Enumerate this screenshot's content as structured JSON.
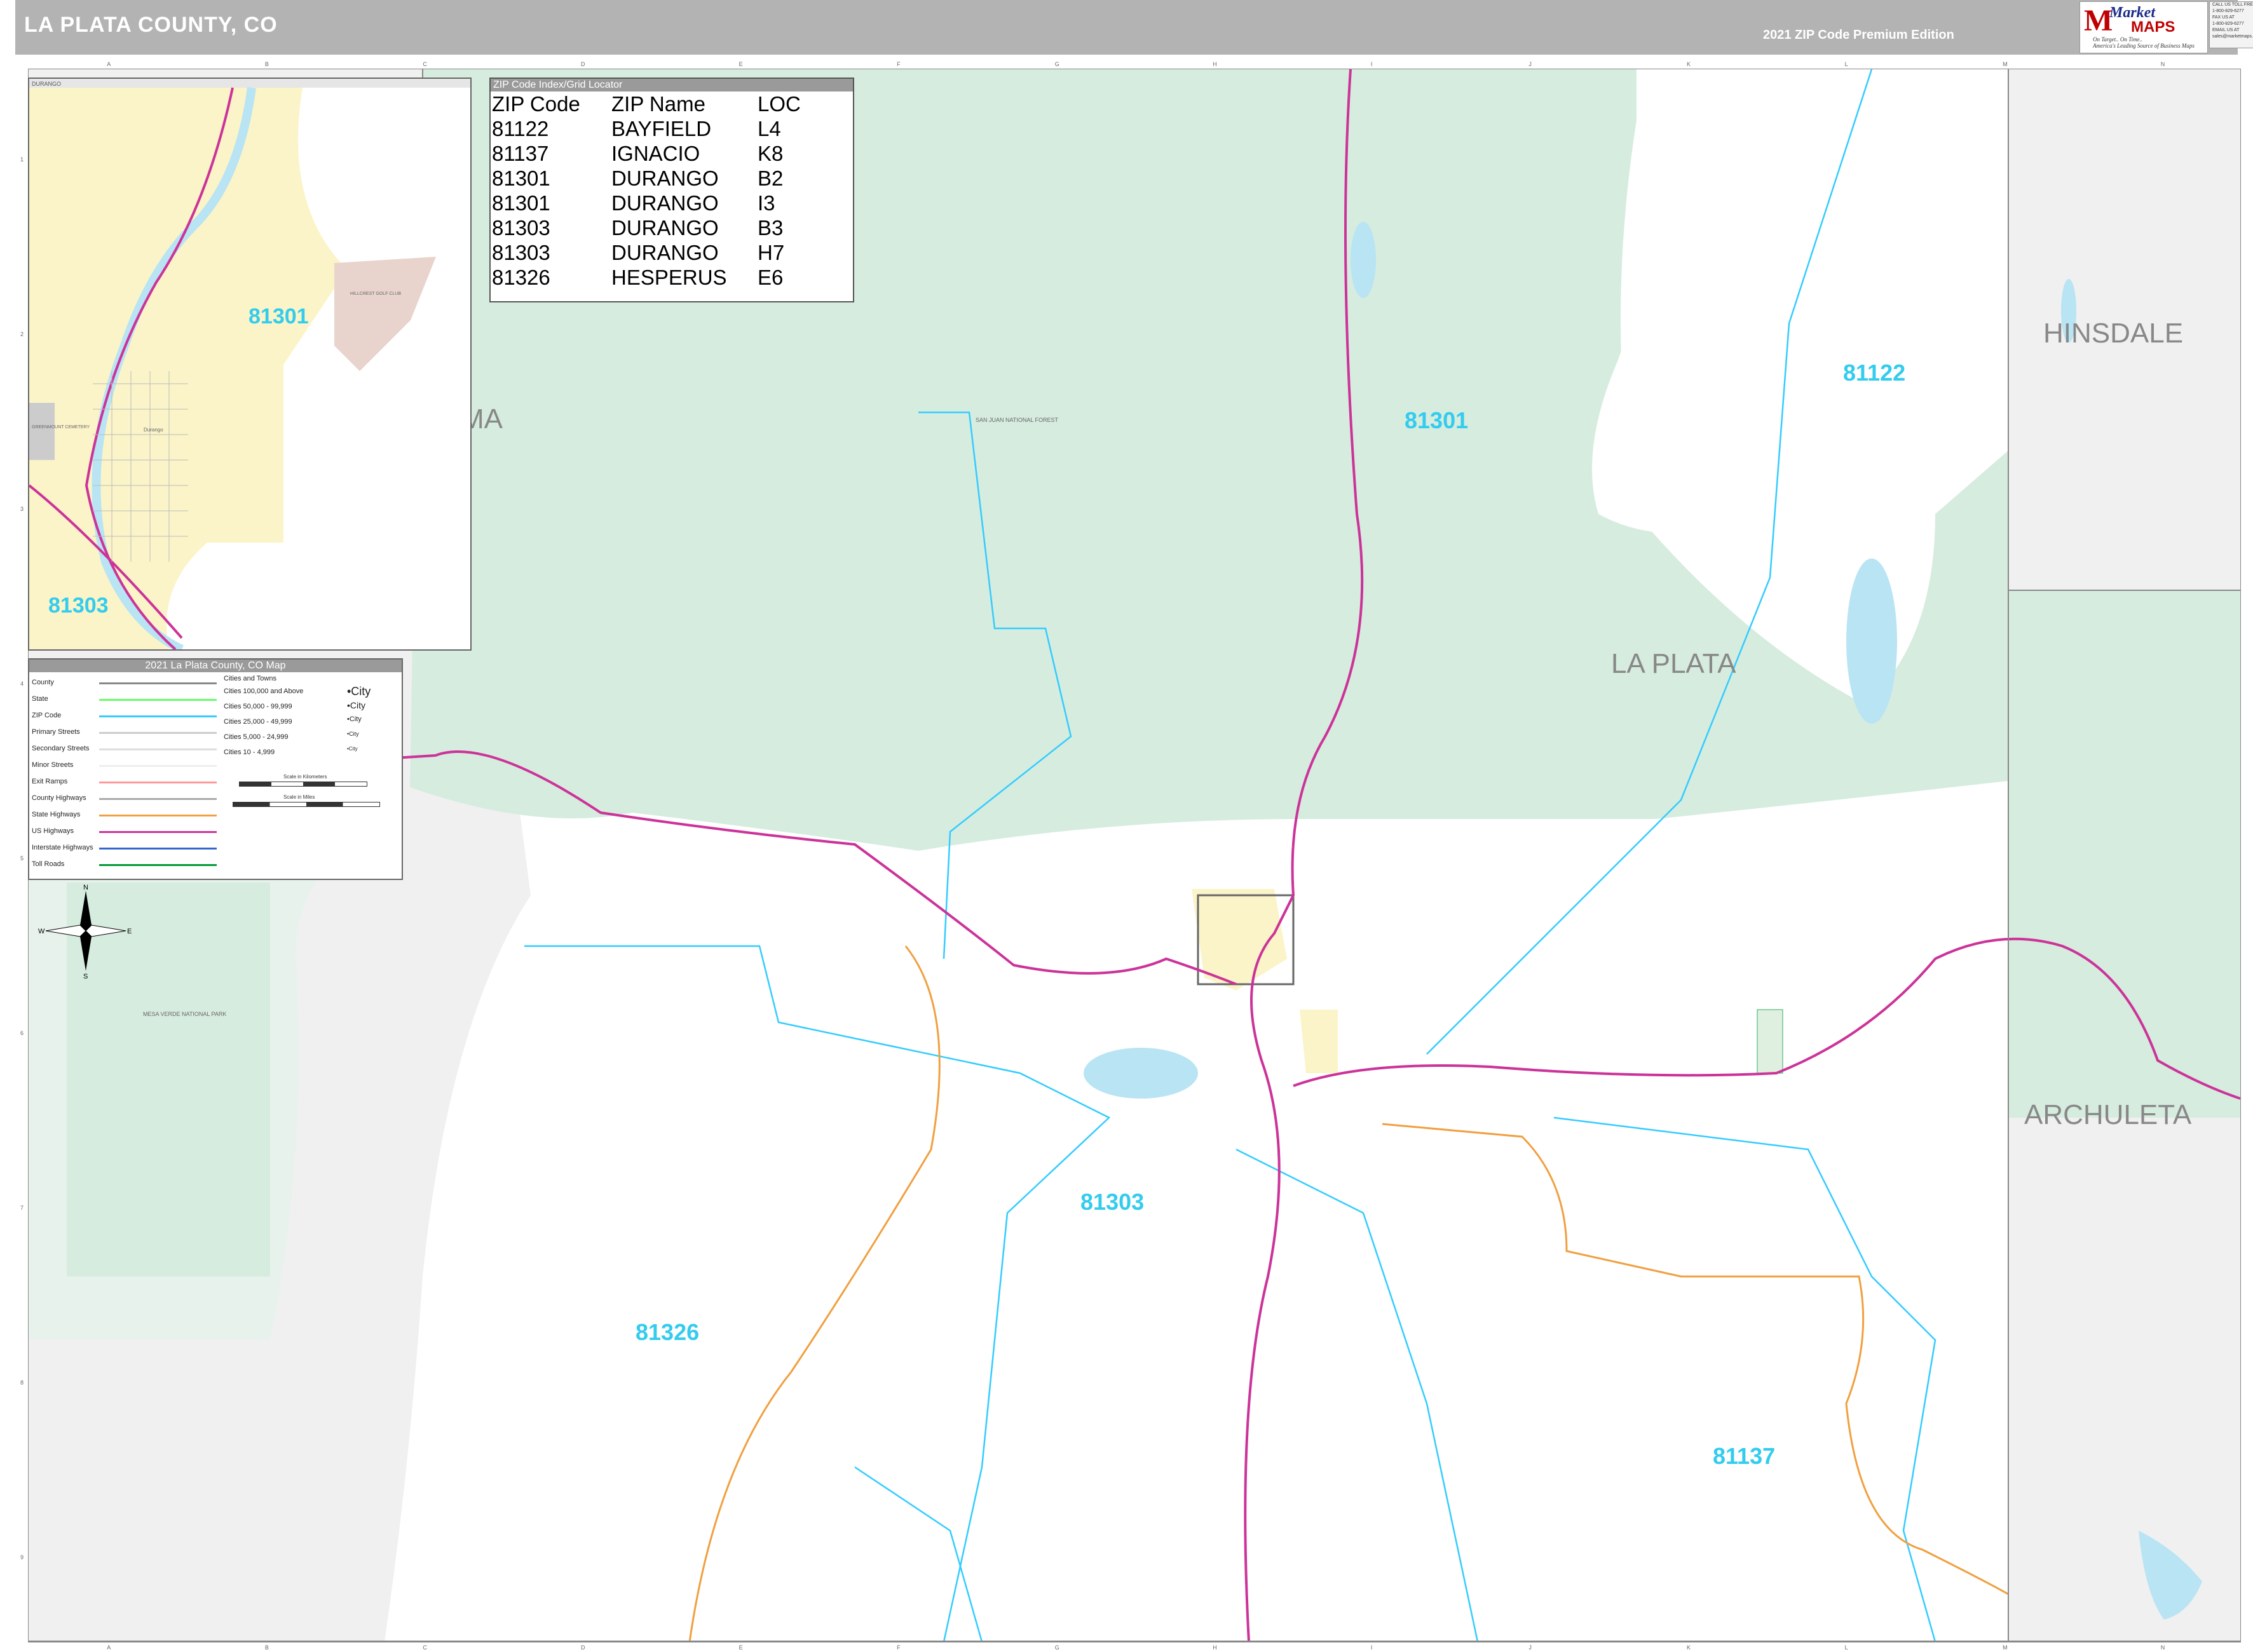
{
  "header": {
    "title": "LA PLATA COUNTY, CO",
    "edition": "2021 ZIP Code Premium Edition",
    "logo_brand_1": "Market",
    "logo_brand_2": "MAPS",
    "logo_tagline_1": "On Target.. On Time..",
    "logo_tagline_2": "America's Leading Source of Business Maps",
    "contact_lines": [
      "CALL US TOLL FREE",
      "1-800-829-6277",
      "FAX US AT",
      "1-800-829-6277",
      "EMAIL US AT",
      "sales@marketmaps.com"
    ]
  },
  "grid": {
    "columns": [
      "A",
      "B",
      "C",
      "D",
      "E",
      "F",
      "G",
      "H",
      "I",
      "J",
      "K",
      "L",
      "M",
      "N"
    ],
    "rows": [
      "1",
      "2",
      "3",
      "4",
      "5",
      "6",
      "7",
      "8",
      "9"
    ]
  },
  "zip_index": {
    "title": "ZIP Code Index/Grid Locator",
    "headers": [
      "ZIP Code",
      "ZIP Name",
      "LOC"
    ],
    "rows": [
      [
        "81122",
        "BAYFIELD",
        "L4"
      ],
      [
        "81137",
        "IGNACIO",
        "K8"
      ],
      [
        "81301",
        "DURANGO",
        "B2"
      ],
      [
        "81301",
        "DURANGO",
        "I3"
      ],
      [
        "81303",
        "DURANGO",
        "B3"
      ],
      [
        "81303",
        "DURANGO",
        "H7"
      ],
      [
        "81326",
        "HESPERUS",
        "E6"
      ]
    ]
  },
  "inset": {
    "label": "DURANGO",
    "zip_labels": [
      "81301",
      "81303"
    ],
    "place_labels": [
      "HILLCREST GOLF CLUB",
      "GREENMOUNT CEMETERY",
      "Durango"
    ]
  },
  "legend": {
    "title": "2021 La Plata County, CO Map",
    "items": [
      "County",
      "State",
      "ZIP Code",
      "Primary Streets",
      "Secondary Streets",
      "Minor Streets",
      "Exit Ramps",
      "County Highways",
      "State Highways",
      "US Highways",
      "Interstate Highways",
      "Toll Roads"
    ],
    "cities_title": "Cities and Towns",
    "cities": [
      {
        "label": "Cities 100,000 and Above",
        "sample": "City"
      },
      {
        "label": "Cities 50,000 - 99,999",
        "sample": "City"
      },
      {
        "label": "Cities 25,000 - 49,999",
        "sample": "City"
      },
      {
        "label": "Cities 5,000 - 24,999",
        "sample": "City"
      },
      {
        "label": "Cities 10 - 4,999",
        "sample": "City"
      }
    ],
    "scale_km": "Scale in Kilometers",
    "scale_miles": "Scale in Miles",
    "colors": {
      "county": "#888888",
      "state": "#66ff66",
      "zip": "#33ccff",
      "primary": "#cccccc",
      "secondary": "#dddddd",
      "minor": "#eeeeee",
      "exit": "#ff9999",
      "county_hwy": "#aaaaaa",
      "state_hwy": "#f0a040",
      "us_hwy": "#cc3399",
      "interstate": "#3366cc",
      "toll": "#009933"
    }
  },
  "compass": {
    "n": "N",
    "s": "S",
    "e": "E",
    "w": "W"
  },
  "map": {
    "county_labels": [
      "HINSDALE",
      "LA PLATA",
      "ARCHULETA",
      "MA"
    ],
    "zip_labels": [
      {
        "zip": "81122"
      },
      {
        "zip": "81301"
      },
      {
        "zip": "81303"
      },
      {
        "zip": "81326"
      },
      {
        "zip": "81137"
      }
    ],
    "place_labels": [
      "SAN JUAN NATIONAL FOREST",
      "MESA VERDE NATIONAL PARK"
    ],
    "colors": {
      "forest": "#d6ecdf",
      "outside": "#f0f0f0",
      "city": "#fbf4c8",
      "water": "#b9e4f4",
      "zip_text": "#33ccee",
      "county_text": "#888888",
      "us_hwy": "#cc3399",
      "state_hwy": "#f0a040"
    }
  }
}
